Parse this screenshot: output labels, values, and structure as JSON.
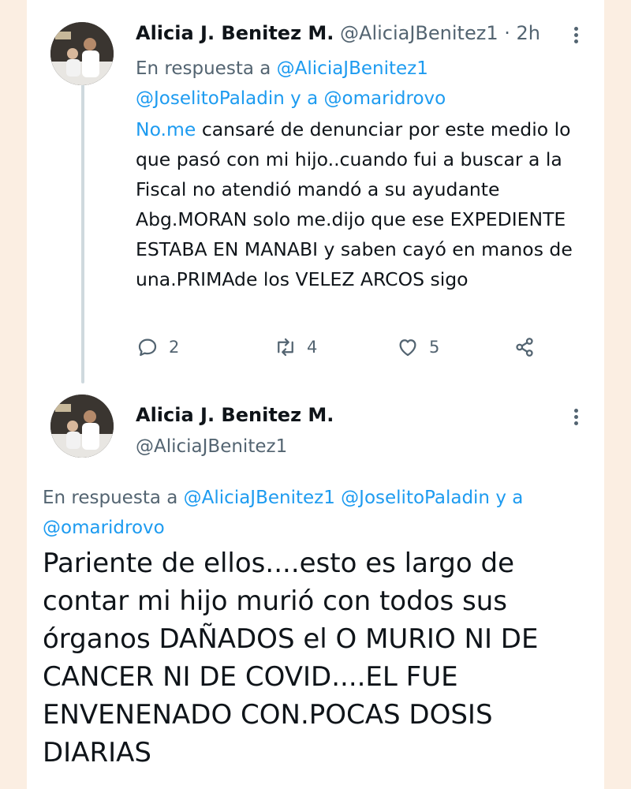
{
  "tweet1": {
    "author_name": "Alicia J. Benitez M.",
    "author_handle": "@AliciaJBenitez1",
    "time": "· 2h",
    "reply_prefix": "En respuesta a",
    "reply_mention_1": "@AliciaJBenitez1",
    "reply_mention_2": "@JoselitoPaladin",
    "reply_joiner": "y a",
    "reply_mention_3": "@omaridrovo",
    "body_link": "No.me",
    "body_text": " cansaré de denunciar por este medio lo que pasó con mi hijo..cuando fui a buscar a la Fiscal no atendió mandó a su ayudante Abg.MORAN solo me.dijo que ese EXPEDIENTE ESTABA EN MANABI y saben cayó en manos de una.PRIMAde los VELEZ ARCOS   sigo",
    "replies": "2",
    "retweets": "4",
    "likes": "5"
  },
  "tweet2": {
    "author_name": "Alicia J. Benitez M.",
    "author_handle": "@AliciaJBenitez1",
    "reply_prefix": "En respuesta a",
    "reply_mention_1": "@AliciaJBenitez1",
    "reply_mention_2": "@JoselitoPaladin",
    "reply_joiner": "y a",
    "reply_mention_3": "@omaridrovo",
    "body_text": "Pariente de ellos....esto es largo de contar mi hijo murió con todos sus órganos DAÑADOS el  O MURIO NI DE CANCER NI DE COVID....EL  FUE ENVENENADO CON.POCAS DOSIS DIARIAS"
  },
  "icons": {
    "reply": "reply-icon",
    "retweet": "retweet-icon",
    "like": "heart-icon",
    "share": "share-icon",
    "more": "more-icon"
  },
  "colors": {
    "mention": "#1d9bf0",
    "secondary_text": "#536471",
    "primary_text": "#0f1419",
    "thread_line": "#cfd9de",
    "edge": "#fbeee2"
  }
}
